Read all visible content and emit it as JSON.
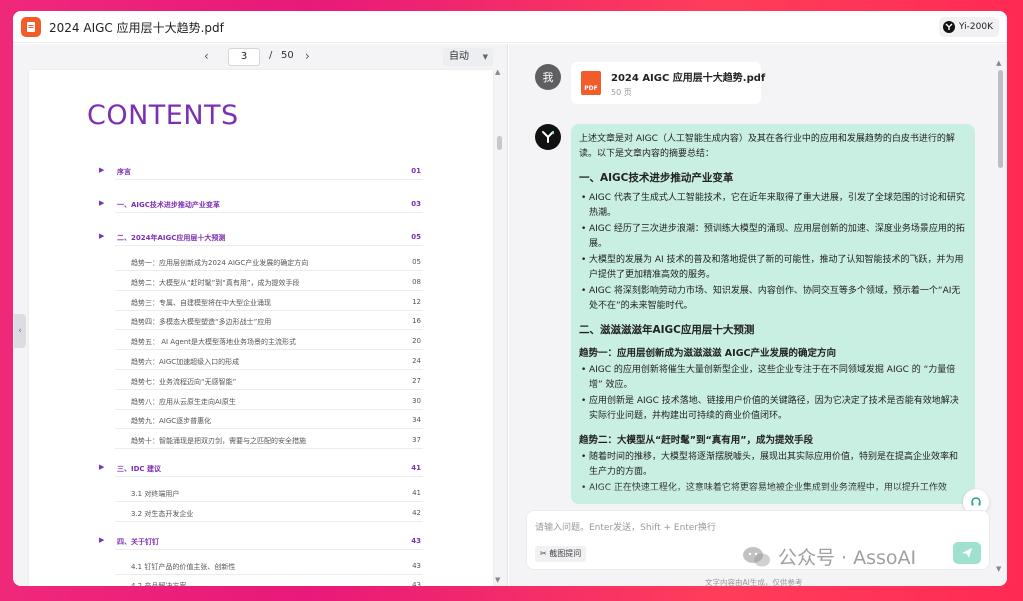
{
  "window": {
    "title": "2024 AIGC 应用层十大趋势.pdf",
    "model_badge": "Yi-200K"
  },
  "pdf_toolbar": {
    "current_page": "3",
    "separator": "/",
    "total_pages": "50",
    "zoom": "自动"
  },
  "pdf": {
    "heading": "CONTENTS",
    "toc": [
      {
        "label": "序言",
        "page": "01",
        "kind": "sec"
      },
      {
        "label": "一、AIGC技术进步推动产业变革",
        "page": "03",
        "kind": "sec"
      },
      {
        "label": "二、2024年AIGC应用层十大预测",
        "page": "05",
        "kind": "sec"
      },
      {
        "label": "趋势一：应用层创新成为2024 AIGC产业发展的确定方向",
        "page": "05",
        "kind": "sub"
      },
      {
        "label": "趋势二：大模型从“赶时髦”到“真有用”，成为提效手段",
        "page": "08",
        "kind": "sub"
      },
      {
        "label": "趋势三：专属、自建模型将在中大型企业涌现",
        "page": "12",
        "kind": "sub"
      },
      {
        "label": "趋势四：多模态大模型塑造“多边形战士”应用",
        "page": "16",
        "kind": "sub"
      },
      {
        "label": "趋势五：  AI Agent是大模型落地业务场景的主流形式",
        "page": "20",
        "kind": "sub"
      },
      {
        "label": "趋势六：AIGC加速超级入口的形成",
        "page": "24",
        "kind": "sub"
      },
      {
        "label": "趋势七：业务流程迈向“无感智能”",
        "page": "27",
        "kind": "sub"
      },
      {
        "label": "趋势八：应用从云原生走向AI原生",
        "page": "30",
        "kind": "sub"
      },
      {
        "label": "趋势九：AIGC逐步普惠化",
        "page": "34",
        "kind": "sub"
      },
      {
        "label": "趋势十：智能涌现是把双刃剑，需要与之匹配的安全措施",
        "page": "37",
        "kind": "sub"
      },
      {
        "label": "三、IDC 建议",
        "page": "41",
        "kind": "sec"
      },
      {
        "label": "3.1 对终端用户",
        "page": "41",
        "kind": "sub"
      },
      {
        "label": "3.2 对生态开发企业",
        "page": "42",
        "kind": "sub"
      },
      {
        "label": "四、关于钉钉",
        "page": "43",
        "kind": "sec"
      },
      {
        "label": "4.1 钉钉产品的价值主张、创新性",
        "page": "43",
        "kind": "sub"
      },
      {
        "label": "4.2 产品解决方案",
        "page": "43",
        "kind": "sub"
      }
    ]
  },
  "chat": {
    "user_avatar": "我",
    "file_card": {
      "name": "2024 AIGC 应用层十大趋势.pdf",
      "pages": "50 页",
      "icon_label": "PDF"
    },
    "answer": {
      "intro": "上述文章是对 AIGC（人工智能生成内容）及其在各行业中的应用和发展趋势的白皮书进行的解读。以下是文章内容的摘要总结：",
      "section1_title": "一、AIGC技术进步推动产业变革",
      "section1_items": [
        "AIGC 代表了生成式人工智能技术，它在近年来取得了重大进展，引发了全球范围的讨论和研究热潮。",
        "AIGC 经历了三次进步浪潮：预训练大模型的涌现、应用层创新的加速、深度业务场景应用的拓展。",
        "大模型的发展为 AI 技术的普及和落地提供了新的可能性，推动了认知智能技术的飞跃，并为用户提供了更加精准高效的服务。",
        "AIGC 将深刻影响劳动力市场、知识发展、内容创作、协同交互等多个领域，预示着一个“AI无处不在”的未来智能时代。"
      ],
      "section2_title": "二、滋滋滋滋年AIGC应用层十大预测",
      "trend1_title": "趋势一：应用层创新成为滋滋滋滋 AIGC产业发展的确定方向",
      "trend1_items": [
        "AIGC 的应用创新将催生大量创新型企业，这些企业专注于在不同领域发掘 AIGC 的 “力量倍增” 效应。",
        "应用创新是 AIGC 技术落地、链接用户价值的关键路径，因为它决定了技术是否能有效地解决实际行业问题，并构建出可持续的商业价值闭环。"
      ],
      "trend2_title": "趋势二：大模型从“赶时髦”到“真有用”，成为提效手段",
      "trend2_items": [
        "随着时间的推移，大模型将逐渐摆脱噱头，展现出其实际应用价值，特别是在提高企业效率和生产力的方面。",
        "AIGC 正在快速工程化，这意味着它将更容易地被企业集成到业务流程中，用以提升工作效"
      ]
    },
    "input_placeholder": "请输入问题。Enter发送，Shift + Enter换行",
    "crop_button": "截图提问",
    "disclaimer": "文字内容由AI生成，仅供参考"
  },
  "watermark": "公众号 · AssoAI",
  "icons": [
    "pdf-app-icon",
    "yi-logo-icon",
    "chevron-left-icon",
    "chevron-right-icon",
    "caret-down-icon",
    "send-icon",
    "scissors-icon",
    "headset-icon",
    "wechat-icon"
  ]
}
